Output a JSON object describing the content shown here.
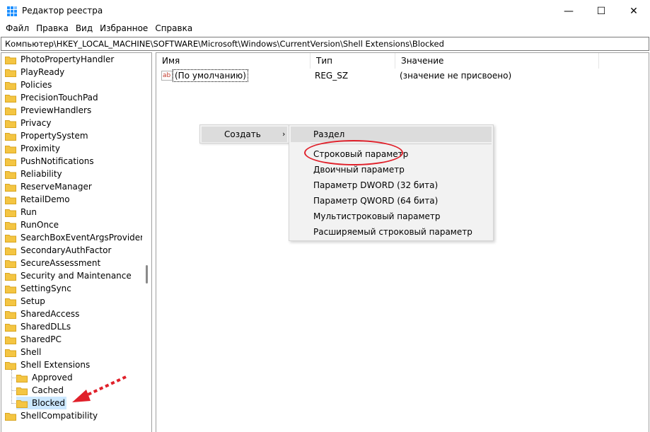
{
  "window": {
    "title": "Редактор реестра",
    "controls": {
      "minimize": "—",
      "maximize": "☐",
      "close": "✕"
    }
  },
  "menu": [
    "Файл",
    "Правка",
    "Вид",
    "Избранное",
    "Справка"
  ],
  "address": "Компьютер\\HKEY_LOCAL_MACHINE\\SOFTWARE\\Microsoft\\Windows\\CurrentVersion\\Shell Extensions\\Blocked",
  "tree": {
    "items": [
      "PhotoPropertyHandler",
      "PlayReady",
      "Policies",
      "PrecisionTouchPad",
      "PreviewHandlers",
      "Privacy",
      "PropertySystem",
      "Proximity",
      "PushNotifications",
      "Reliability",
      "ReserveManager",
      "RetailDemo",
      "Run",
      "RunOnce",
      "SearchBoxEventArgsProvider",
      "SecondaryAuthFactor",
      "SecureAssessment",
      "Security and Maintenance",
      "SettingSync",
      "Setup",
      "SharedAccess",
      "SharedDLLs",
      "SharedPC",
      "Shell",
      "Shell Extensions"
    ],
    "children": [
      "Approved",
      "Cached",
      "Blocked"
    ],
    "after": [
      "ShellCompatibility"
    ],
    "selected": "Blocked"
  },
  "list": {
    "columns": {
      "name": "Имя",
      "type": "Тип",
      "value": "Значение"
    },
    "rows": [
      {
        "name": "(По умолчанию)",
        "type": "REG_SZ",
        "value": "(значение не присвоено)",
        "icon": "ab"
      }
    ]
  },
  "context_menu": {
    "create": "Создать",
    "arrow": "›",
    "submenu": [
      "Раздел",
      "Строковый параметр",
      "Двоичный параметр",
      "Параметр DWORD (32 бита)",
      "Параметр QWORD (64 бита)",
      "Мультистроковый параметр",
      "Расширяемый строковый параметр"
    ]
  },
  "colors": {
    "selection": "#cce8ff",
    "folder": "#f4c542",
    "annotation": "#e0202a",
    "menu_bg": "#f2f2f2",
    "menu_hover": "#dcdcdc"
  }
}
